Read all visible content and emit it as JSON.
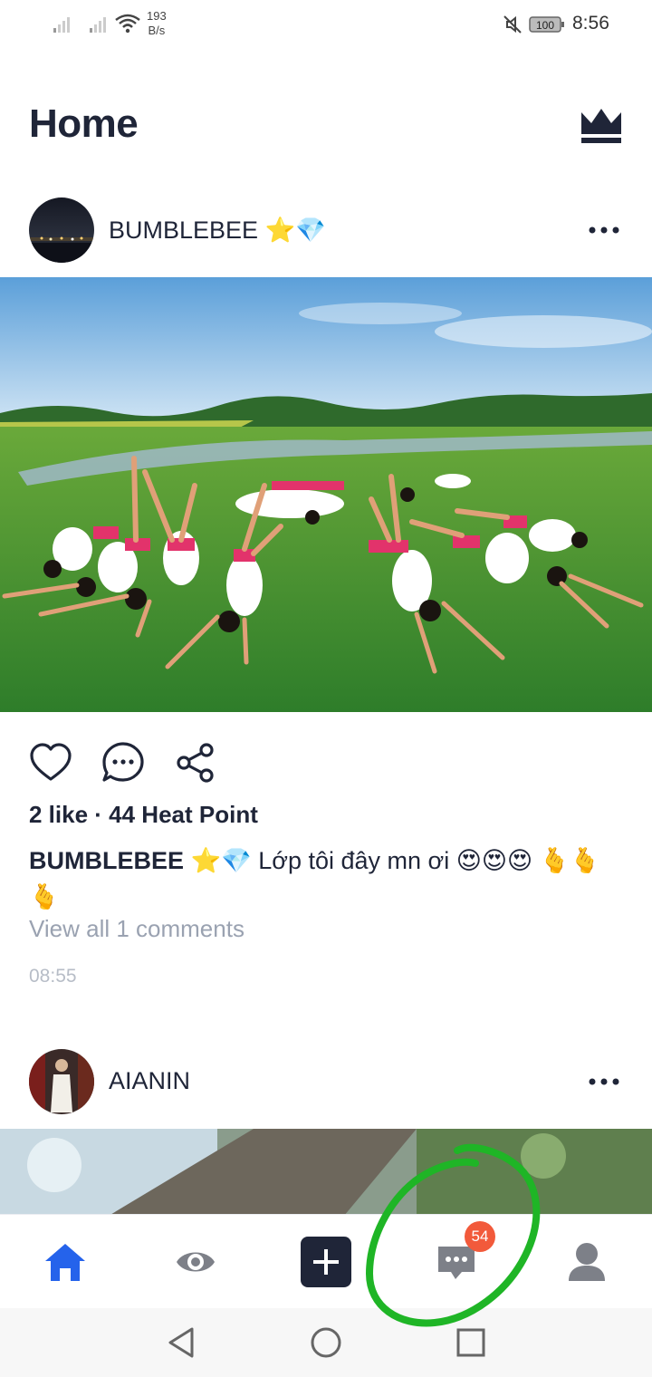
{
  "status_bar": {
    "net_speed_value": "193",
    "net_speed_unit": "B/s",
    "battery": "100",
    "time": "8:56",
    "icons": [
      "signal-icon",
      "signal-icon",
      "wifi-icon",
      "mute-icon",
      "battery-icon"
    ]
  },
  "header": {
    "title": "Home",
    "crown_icon": "crown-icon"
  },
  "posts": [
    {
      "username": "BUMBLEBEE ⭐💎",
      "likes_text": "2 like · 44 Heat Point",
      "caption_user": "BUMBLEBEE ⭐💎",
      "caption_text": " Lớp tôi đây mn ơi 😍😍😍 🫰🫰🫰",
      "view_comments": "View all 1 comments",
      "time": "08:55"
    },
    {
      "username": "AIANIN"
    }
  ],
  "actions": [
    "heart-icon",
    "comment-icon",
    "share-icon"
  ],
  "tabs": [
    "home-icon",
    "eye-icon",
    "plus-icon",
    "chat-icon",
    "profile-icon"
  ],
  "chat_badge": "54",
  "colors": {
    "accent": "#2563eb",
    "badge": "#f25a3b",
    "annotation": "#1fb526"
  }
}
